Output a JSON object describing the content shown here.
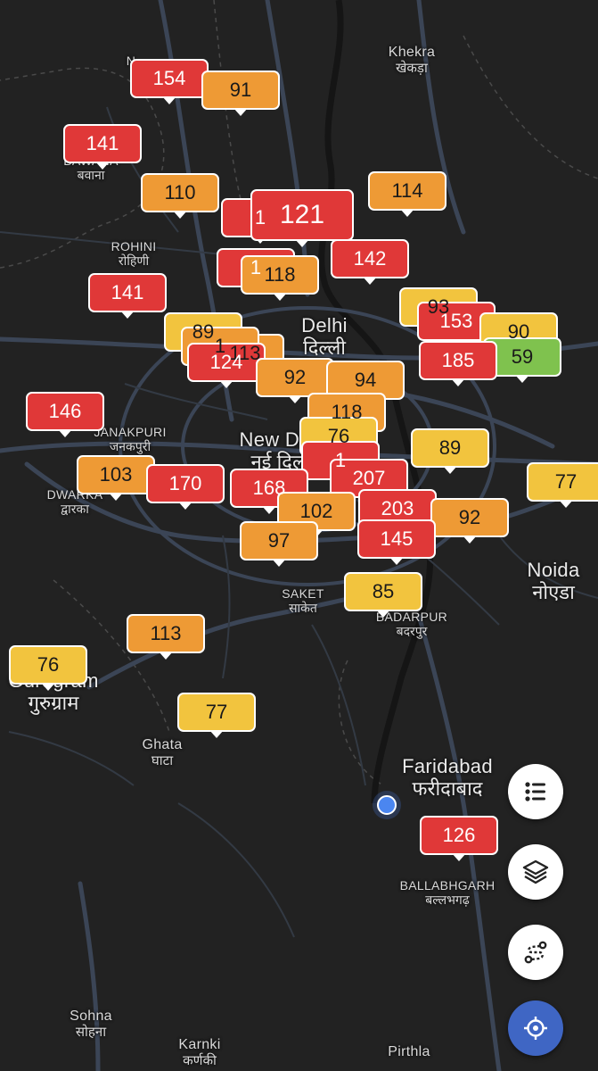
{
  "colors": {
    "red": "#e03838",
    "orange": "#ee9a35",
    "yellow": "#f2c43e",
    "green": "#7fc24e",
    "background": "#222222",
    "road": "#3b4556",
    "locate_button": "#3f66c4"
  },
  "places": [
    {
      "en": "N",
      "hi": ""
    },
    {
      "en": "Khekra",
      "hi": "खेकड़ा"
    },
    {
      "en": "BAWANA",
      "hi": "बवाना"
    },
    {
      "en": "ROHINI",
      "hi": "रोहिणी"
    },
    {
      "en": "Delhi",
      "hi": "दिल्ली"
    },
    {
      "en": "New Delhi",
      "hi": "नई दिल्ली"
    },
    {
      "en": "JANAKPURI",
      "hi": "जनकपुरी"
    },
    {
      "en": "DWARKA",
      "hi": "द्वारका"
    },
    {
      "en": "Noida",
      "hi": "नोएडा"
    },
    {
      "en": "SAKET",
      "hi": "साकेत"
    },
    {
      "en": "BADARPUR",
      "hi": "बदरपुर"
    },
    {
      "en": "Gurugram",
      "hi": "गुरुग्राम"
    },
    {
      "en": "Ghata",
      "hi": "घाटा"
    },
    {
      "en": "Faridabad",
      "hi": "फरीदाबाद"
    },
    {
      "en": "BALLABHGARH",
      "hi": "बल्लभगढ़"
    },
    {
      "en": "Sohna",
      "hi": "सोहना"
    },
    {
      "en": "Karnki",
      "hi": "कर्णकी"
    },
    {
      "en": "Pirthla",
      "hi": ""
    }
  ],
  "aqi_markers": [
    {
      "value": "141",
      "level": "red"
    },
    {
      "value": "110",
      "level": "orange"
    },
    {
      "value": "114",
      "level": "orange"
    },
    {
      "value": "154",
      "level": "red"
    },
    {
      "value": "91",
      "level": "orange"
    },
    {
      "value": "1",
      "level": "red"
    },
    {
      "value": "1",
      "level": "red"
    },
    {
      "value": "121",
      "level": "red"
    },
    {
      "value": "142",
      "level": "red"
    },
    {
      "value": "118",
      "level": "orange"
    },
    {
      "value": "141",
      "level": "red"
    },
    {
      "value": "89",
      "level": "yellow"
    },
    {
      "value": "93",
      "level": "yellow"
    },
    {
      "value": "153",
      "level": "red"
    },
    {
      "value": "90",
      "level": "yellow"
    },
    {
      "value": "59",
      "level": "green"
    },
    {
      "value": "185",
      "level": "red"
    },
    {
      "value": "113",
      "level": "orange"
    },
    {
      "value": "1",
      "level": "orange"
    },
    {
      "value": "124",
      "level": "red"
    },
    {
      "value": "92",
      "level": "orange"
    },
    {
      "value": "94",
      "level": "orange"
    },
    {
      "value": "146",
      "level": "red"
    },
    {
      "value": "118",
      "level": "orange"
    },
    {
      "value": "76",
      "level": "yellow"
    },
    {
      "value": "89",
      "level": "yellow"
    },
    {
      "value": "1",
      "level": "red"
    },
    {
      "value": "103",
      "level": "orange"
    },
    {
      "value": "170",
      "level": "red"
    },
    {
      "value": "168",
      "level": "red"
    },
    {
      "value": "207",
      "level": "red"
    },
    {
      "value": "77",
      "level": "yellow"
    },
    {
      "value": "102",
      "level": "orange"
    },
    {
      "value": "203",
      "level": "red"
    },
    {
      "value": "92",
      "level": "orange"
    },
    {
      "value": "97",
      "level": "orange"
    },
    {
      "value": "145",
      "level": "red"
    },
    {
      "value": "85",
      "level": "yellow"
    },
    {
      "value": "113",
      "level": "orange"
    },
    {
      "value": "76",
      "level": "yellow"
    },
    {
      "value": "77",
      "level": "yellow"
    },
    {
      "value": "126",
      "level": "red"
    }
  ],
  "controls": {
    "list": "list-icon",
    "layers": "layers-icon",
    "route": "route-icon",
    "locate": "crosshair-icon"
  }
}
